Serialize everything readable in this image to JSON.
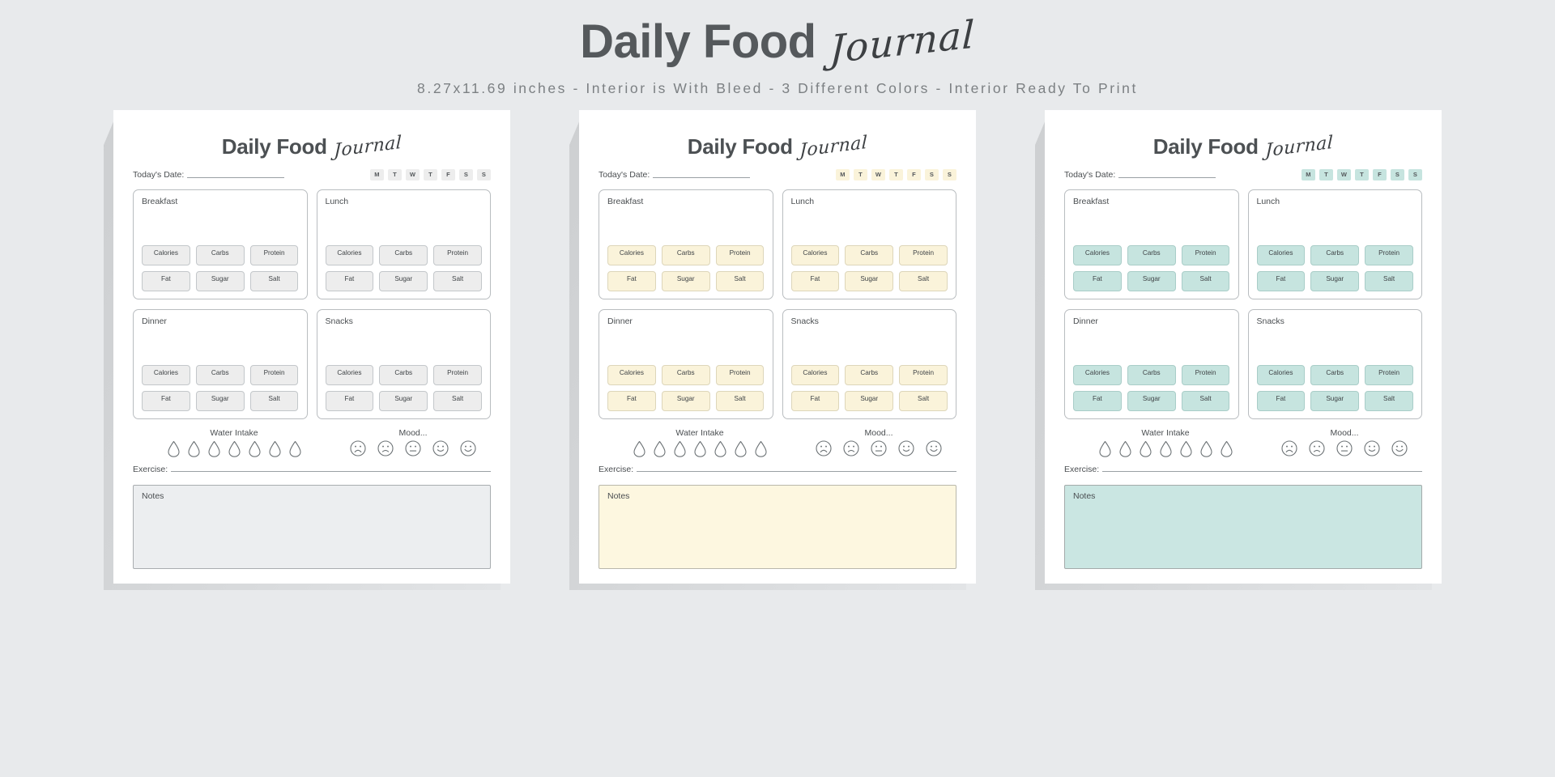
{
  "banner": {
    "title_bold": "Daily Food",
    "title_script": "Journal",
    "subtitle": "8.27x11.69 inches - Interior is With Bleed - 3 Different Colors - Interior Ready To Print",
    "title_color": "#55595c",
    "background_color": "#e8eaec"
  },
  "page_common": {
    "title_bold": "Daily Food",
    "title_script": "Journal",
    "date_label": "Today's Date:",
    "weekdays": [
      "M",
      "T",
      "W",
      "T",
      "F",
      "S",
      "S"
    ],
    "meals": [
      "Breakfast",
      "Lunch",
      "Dinner",
      "Snacks"
    ],
    "nutrients": [
      "Calories",
      "Carbs",
      "Protein",
      "Fat",
      "Sugar",
      "Salt"
    ],
    "water_label": "Water Intake",
    "water_drop_count": 7,
    "mood_label": "Mood...",
    "mood_faces": [
      "very-sad",
      "sad",
      "neutral",
      "happy",
      "very-happy"
    ],
    "exercise_label": "Exercise:",
    "notes_label": "Notes"
  },
  "pages": [
    {
      "variant": "grey",
      "chip_fill": "#ededed",
      "chip_border": "#c3c7ca",
      "weekday_fill": "#ededed",
      "notes_fill": "#eceef0",
      "notes_border": "#a9adb0"
    },
    {
      "variant": "cream",
      "chip_fill": "#faf3da",
      "chip_border": "#ddd6ba",
      "weekday_fill": "#faf3da",
      "notes_fill": "#fdf7e0",
      "notes_border": "#b9b7ab"
    },
    {
      "variant": "teal",
      "chip_fill": "#c6e4df",
      "chip_border": "#a9cdc8",
      "weekday_fill": "#c6e4df",
      "notes_fill": "#cae6e2",
      "notes_border": "#a3aaaa"
    }
  ]
}
